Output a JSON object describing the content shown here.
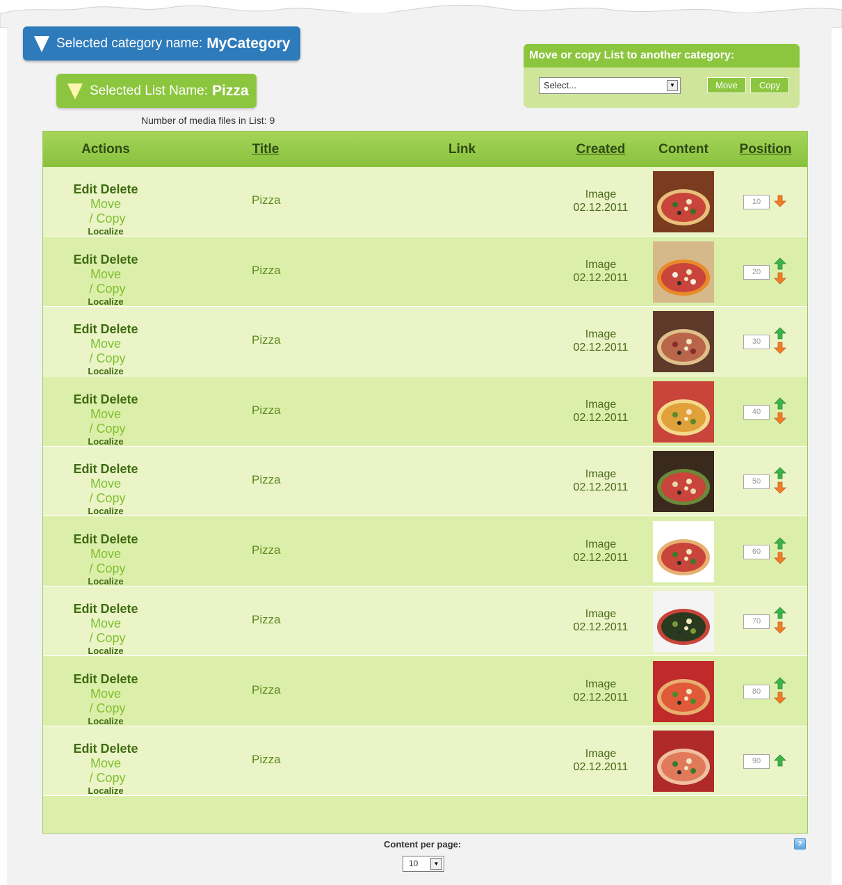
{
  "category": {
    "label": "Selected category name:",
    "value": "MyCategory"
  },
  "list": {
    "label": "Selected List Name:",
    "value": "Pizza"
  },
  "media_count": {
    "label": "Number of media files in List:",
    "value": "9"
  },
  "move_copy": {
    "title": "Move or copy List to another category:",
    "select_value": "Select...",
    "move_label": "Move",
    "copy_label": "Copy"
  },
  "table": {
    "headers": {
      "actions": "Actions",
      "title": "Title",
      "link": "Link",
      "created": "Created",
      "content": "Content",
      "position": "Position"
    },
    "action_labels": {
      "edit": "Edit",
      "delete": "Delete",
      "move": "Move",
      "sep": " / ",
      "copy": "Copy",
      "localize": "Localize"
    },
    "rows": [
      {
        "title": "Pizza",
        "type": "Image",
        "date": "02.12.2011",
        "position": "10",
        "up": false,
        "down": true
      },
      {
        "title": "Pizza",
        "type": "Image",
        "date": "02.12.2011",
        "position": "20",
        "up": true,
        "down": true
      },
      {
        "title": "Pizza",
        "type": "Image",
        "date": "02.12.2011",
        "position": "30",
        "up": true,
        "down": true
      },
      {
        "title": "Pizza",
        "type": "Image",
        "date": "02.12.2011",
        "position": "40",
        "up": true,
        "down": true
      },
      {
        "title": "Pizza",
        "type": "Image",
        "date": "02.12.2011",
        "position": "50",
        "up": true,
        "down": true
      },
      {
        "title": "Pizza",
        "type": "Image",
        "date": "02.12.2011",
        "position": "60",
        "up": true,
        "down": true
      },
      {
        "title": "Pizza",
        "type": "Image",
        "date": "02.12.2011",
        "position": "70",
        "up": true,
        "down": true
      },
      {
        "title": "Pizza",
        "type": "Image",
        "date": "02.12.2011",
        "position": "80",
        "up": true,
        "down": true
      },
      {
        "title": "Pizza",
        "type": "Image",
        "date": "02.12.2011",
        "position": "90",
        "up": true,
        "down": false
      }
    ]
  },
  "pagination": {
    "label": "Content per page:",
    "value": "10"
  },
  "colors": {
    "category_pill": "#2e7bbb",
    "list_pill": "#8cc63f",
    "header_green": "#8cc63f",
    "arrow_up": "#3db34a",
    "arrow_down": "#f07d2a"
  }
}
